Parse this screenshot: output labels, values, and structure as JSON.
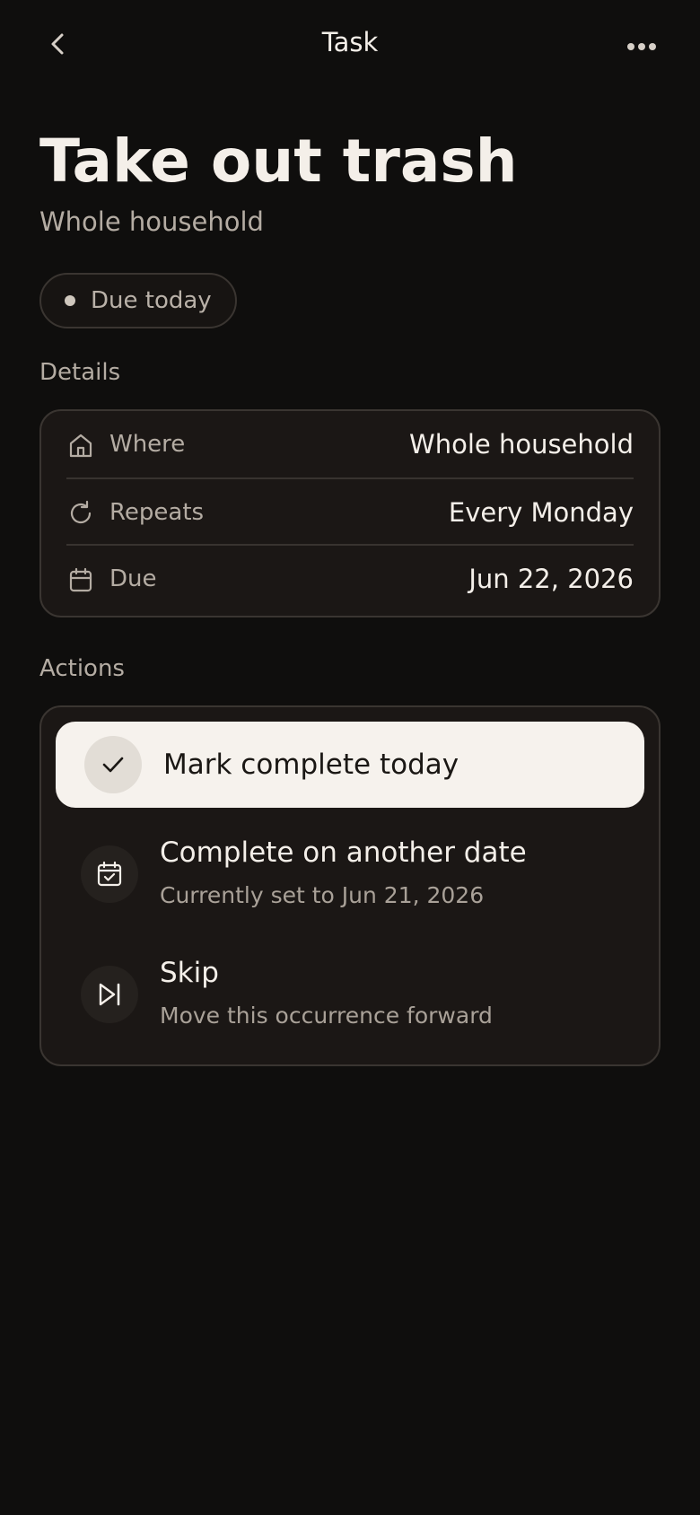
{
  "topbar": {
    "title": "Task",
    "back_icon": "chevron-left-icon",
    "more_icon": "more-horizontal-icon"
  },
  "header": {
    "title": "Take out trash",
    "subtitle": "Whole household",
    "status": "Due today"
  },
  "details": {
    "section_label": "Details",
    "rows": [
      {
        "icon": "home-icon",
        "label": "Where",
        "value": "Whole household"
      },
      {
        "icon": "repeat-icon",
        "label": "Repeats",
        "value": "Every Monday"
      },
      {
        "icon": "calendar-icon",
        "label": "Due",
        "value": "Jun 22, 2026"
      }
    ]
  },
  "actions": {
    "section_label": "Actions",
    "primary": {
      "icon": "check-icon",
      "label": "Mark complete today"
    },
    "items": [
      {
        "icon": "calendar-check-icon",
        "title": "Complete on another date",
        "subtitle": "Currently set to Jun 21, 2026"
      },
      {
        "icon": "skip-forward-icon",
        "title": "Skip",
        "subtitle": "Move this occurrence forward"
      }
    ]
  },
  "colors": {
    "background": "#0f0e0d",
    "card": "#1b1715",
    "border": "#3a3531",
    "text_primary": "#f4efe9",
    "text_secondary": "#b4aca3",
    "primary_button": "#f6f2ed"
  }
}
